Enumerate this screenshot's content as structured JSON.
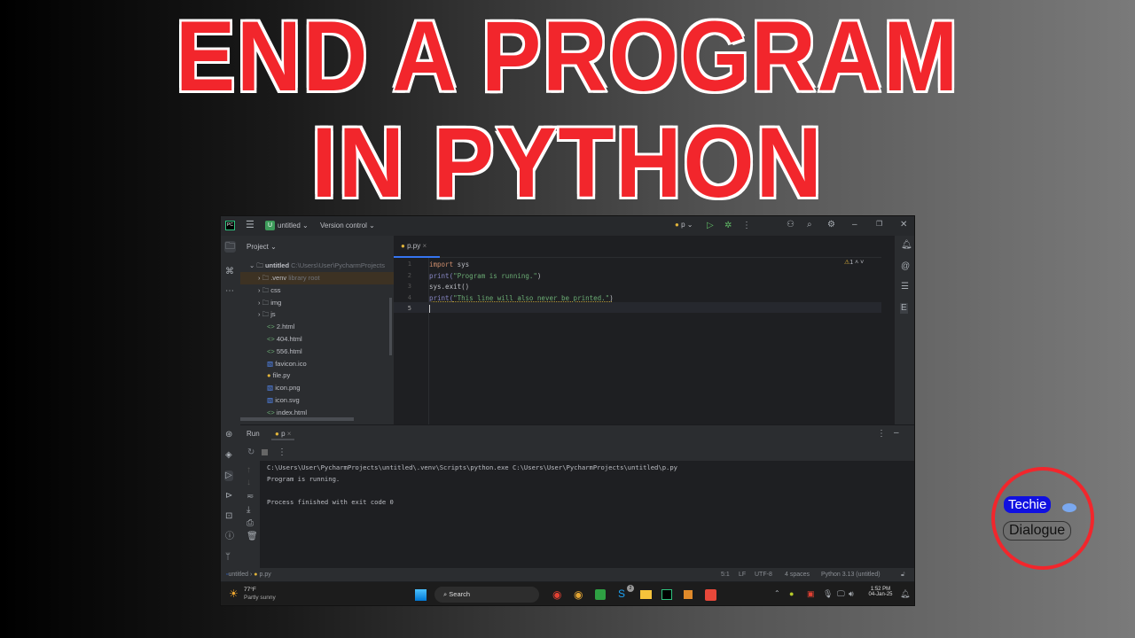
{
  "headline": {
    "line1": "END A PROGRAM",
    "line2": "IN PYTHON"
  },
  "ide": {
    "titlebar": {
      "project_badge": "U",
      "project": "untitled",
      "vcs": "Version control",
      "run_config": "p"
    },
    "project_panel": {
      "header": "Project",
      "root": "untitled",
      "root_path": "C:\\Users\\User\\PycharmProjects",
      "items": [
        {
          "name": ".venv",
          "hint": "library root",
          "type": "folder"
        },
        {
          "name": "css",
          "type": "folder"
        },
        {
          "name": "img",
          "type": "folder"
        },
        {
          "name": "js",
          "type": "folder"
        },
        {
          "name": "2.html",
          "type": "html"
        },
        {
          "name": "404.html",
          "type": "html"
        },
        {
          "name": "556.html",
          "type": "html"
        },
        {
          "name": "favicon.ico",
          "type": "image"
        },
        {
          "name": "file.py",
          "type": "python"
        },
        {
          "name": "icon.png",
          "type": "image"
        },
        {
          "name": "icon.svg",
          "type": "image"
        },
        {
          "name": "index.html",
          "type": "html"
        }
      ]
    },
    "editor": {
      "tab": "p.py",
      "warnings": "1",
      "lines": [
        {
          "n": "1",
          "kw": "import",
          "rest": " sys"
        },
        {
          "n": "2",
          "fn": "print(",
          "str": "\"Program is running.\"",
          "end": ")"
        },
        {
          "n": "3",
          "plain": "sys.exit()"
        },
        {
          "n": "4",
          "fn": "print(",
          "str": "\"This line will also never be printed.\"",
          "end": ")"
        },
        {
          "n": "5",
          "plain": ""
        }
      ]
    },
    "run": {
      "label": "Run",
      "tab": "p",
      "output": [
        "C:\\Users\\User\\PycharmProjects\\untitled\\.venv\\Scripts\\python.exe C:\\Users\\User\\PycharmProjects\\untitled\\p.py",
        "Program is running.",
        "Process finished with exit code 0"
      ]
    },
    "statusbar": {
      "crumb_project": "untitled",
      "crumb_file": "p.py",
      "position": "5:1",
      "line_sep": "LF",
      "encoding": "UTF-8",
      "indent": "4 spaces",
      "interpreter": "Python 3.13 (untitled)"
    },
    "taskbar": {
      "temp": "77°F",
      "weather": "Partly sunny",
      "search": "Search",
      "time": "1:52 PM",
      "date": "04-Jan-25",
      "badge": "2"
    }
  },
  "logo": {
    "top": "Techie",
    "bottom": "Dialogue"
  }
}
